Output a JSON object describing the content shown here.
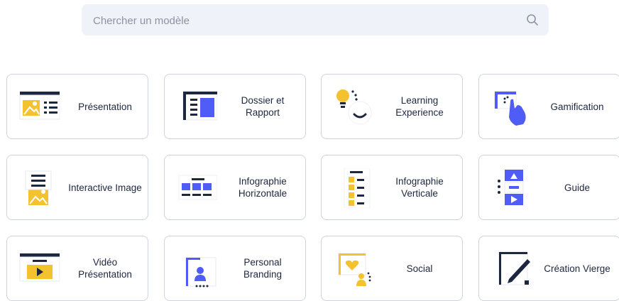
{
  "search": {
    "placeholder": "Chercher un modèle",
    "icon": "search-icon"
  },
  "colors": {
    "navy": "#1e2740",
    "blue": "#4f5cf5",
    "yellow": "#f5c22f",
    "border": "#cfd3dd",
    "search_bg": "#f0f2f9"
  },
  "templates": [
    {
      "label": "Présentation",
      "icon": "presentation-icon"
    },
    {
      "label": "Dossier et Rapport",
      "icon": "report-icon"
    },
    {
      "label": "Learning Experience",
      "icon": "learning-icon"
    },
    {
      "label": "Gamification",
      "icon": "gamification-icon"
    },
    {
      "label": "Interactive Image",
      "icon": "interactive-image-icon"
    },
    {
      "label": "Infographie Horizontale",
      "icon": "horizontal-infographic-icon"
    },
    {
      "label": "Infographie Verticale",
      "icon": "vertical-infographic-icon"
    },
    {
      "label": "Guide",
      "icon": "guide-icon"
    },
    {
      "label": "Vidéo Présentation",
      "icon": "video-presentation-icon"
    },
    {
      "label": "Personal Branding",
      "icon": "personal-branding-icon"
    },
    {
      "label": "Social",
      "icon": "social-icon"
    },
    {
      "label": "Création Vierge",
      "icon": "blank-creation-icon"
    }
  ]
}
